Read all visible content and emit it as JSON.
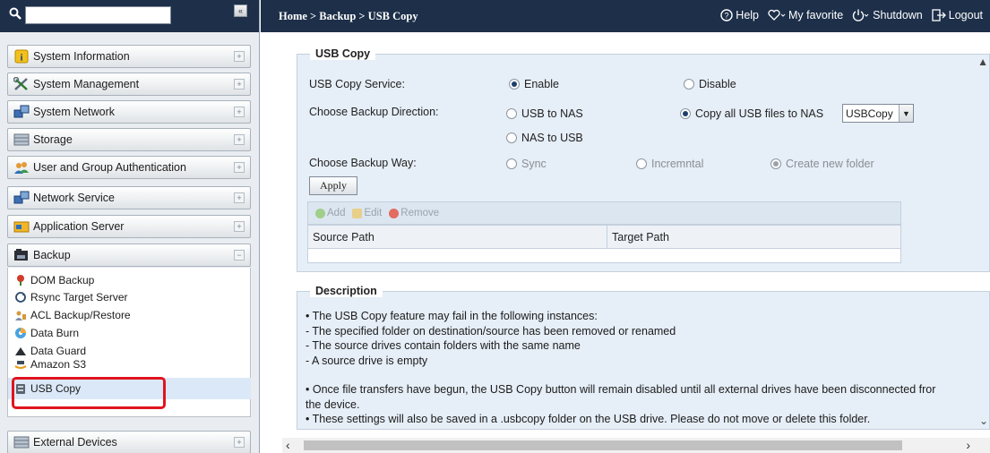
{
  "search": {
    "placeholder": "",
    "collapse_label": "«"
  },
  "sidebar": {
    "menus": [
      {
        "label": "System Information",
        "icon": "info-icon"
      },
      {
        "label": "System Management",
        "icon": "tools-icon"
      },
      {
        "label": "System Network",
        "icon": "network-icon"
      },
      {
        "label": "Storage",
        "icon": "storage-icon"
      },
      {
        "label": "User and Group Authentication",
        "icon": "users-icon"
      },
      {
        "label": "Network Service",
        "icon": "network-service-icon"
      },
      {
        "label": "Application Server",
        "icon": "app-server-icon"
      },
      {
        "label": "Backup",
        "icon": "backup-icon"
      },
      {
        "label": "External Devices",
        "icon": "external-devices-icon"
      }
    ],
    "expand_symbol": "+",
    "collapse_symbol": "−",
    "backup_items": [
      {
        "label": "DOM Backup",
        "icon": "dom-backup-icon"
      },
      {
        "label": "Rsync Target Server",
        "icon": "rsync-icon"
      },
      {
        "label": "ACL Backup/Restore",
        "icon": "acl-icon"
      },
      {
        "label": "Data Burn",
        "icon": "data-burn-icon"
      },
      {
        "label": "Data Guard",
        "icon": "data-guard-icon"
      },
      {
        "label": "Amazon S3",
        "icon": "amazon-s3-icon"
      },
      {
        "label": "USB Copy",
        "icon": "usb-copy-icon"
      }
    ],
    "selected": "USB Copy"
  },
  "topbar": {
    "breadcrumb": "Home > Backup > USB Copy",
    "help": "Help",
    "favorite": "My favorite",
    "shutdown": "Shutdown",
    "logout": "Logout"
  },
  "usb_copy": {
    "legend": "USB Copy",
    "service_label": "USB Copy Service:",
    "enable": "Enable",
    "disable": "Disable",
    "direction_label": "Choose Backup Direction:",
    "usb_to_nas": "USB to NAS",
    "nas_to_usb": "NAS to USB",
    "copy_all": "Copy all USB files to NAS",
    "folder_value": "USBCopy",
    "way_label": "Choose Backup Way:",
    "sync": "Sync",
    "incremental": "Incremntal",
    "new_folder": "Create new folder",
    "apply": "Apply",
    "add": "Add",
    "edit": "Edit",
    "remove": "Remove",
    "col_source": "Source Path",
    "col_target": "Target Path"
  },
  "description": {
    "legend": "Description",
    "lines": [
      "• The USB Copy feature may fail in the following instances:",
      "- The specified folder on destination/source has been removed or renamed",
      "- The source drives contain folders with the same name",
      "- A source drive is empty",
      "",
      "• Once file transfers have begun, the USB Copy button will remain disabled until all external drives have been disconnected fror",
      "the device.",
      "• These settings will also be saved in a .usbcopy folder on the USB drive. Please do not move or delete this folder."
    ]
  },
  "colors": {
    "topbar": "#1d2f49",
    "panel": "#e6eef7",
    "highlight": "#e0141e"
  }
}
